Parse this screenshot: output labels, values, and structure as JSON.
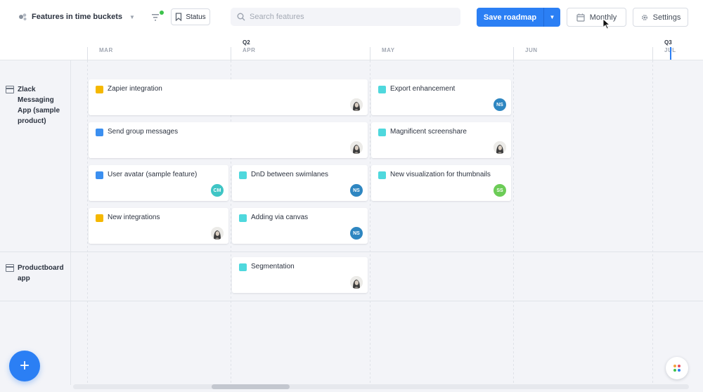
{
  "toolbar": {
    "board_title": "Features in time buckets",
    "status_label": "Status",
    "search_placeholder": "Search features",
    "save_label": "Save roadmap",
    "monthly_label": "Monthly",
    "settings_label": "Settings"
  },
  "timeline": {
    "quarters": [
      "Q2",
      "Q3"
    ],
    "months": [
      "MAR",
      "APR",
      "MAY",
      "JUN",
      "JUL"
    ]
  },
  "lanes": [
    {
      "name": "Zlack Messaging App (sample product)"
    },
    {
      "name": "Productboard app"
    }
  ],
  "cards": [
    {
      "title": "Zapier integration",
      "color": "#f5b800",
      "avatar": "photo"
    },
    {
      "title": "Export enhancement",
      "color": "#4fd8dd",
      "avatar": "NS",
      "avatar_color": "#2e86c1"
    },
    {
      "title": "Send group messages",
      "color": "#3b8ff0",
      "avatar": "photo"
    },
    {
      "title": "Magnificent screenshare",
      "color": "#4fd8dd",
      "avatar": "photo"
    },
    {
      "title": "User avatar (sample feature)",
      "color": "#3b8ff0",
      "avatar": "CM",
      "avatar_color": "#3fc5c5"
    },
    {
      "title": "DnD between swimlanes",
      "color": "#4fd8dd",
      "avatar": "NS",
      "avatar_color": "#2e86c1"
    },
    {
      "title": "New visualization for thumbnails",
      "color": "#4fd8dd",
      "avatar": "SS",
      "avatar_color": "#6ccc57"
    },
    {
      "title": "New integrations",
      "color": "#f5b800",
      "avatar": "photo"
    },
    {
      "title": "Adding via canvas",
      "color": "#4fd8dd",
      "avatar": "NS",
      "avatar_color": "#2e86c1"
    },
    {
      "title": "Segmentation",
      "color": "#4fd8dd",
      "avatar": "photo"
    }
  ],
  "fab_label": "+",
  "colors": {
    "accent": "#2b7ff4",
    "filter_active": "#3dc24b"
  }
}
